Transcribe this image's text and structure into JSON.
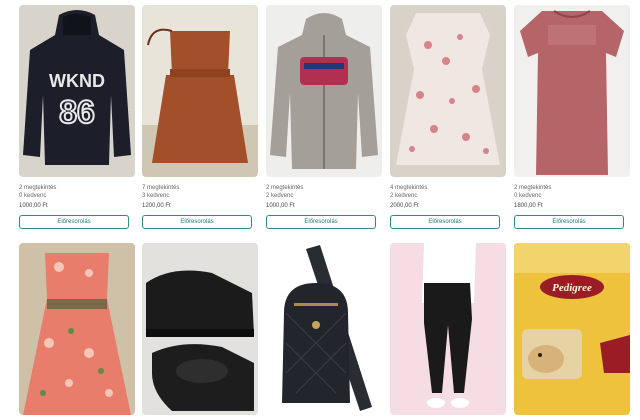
{
  "listings": [
    {
      "views": "2 megtekintés",
      "favorites": "0 kedvenc",
      "price": "1000,00 Ft",
      "button": "Előresorolás",
      "image": "black-hoodie-wknd-86",
      "print_text_1": "WKND",
      "print_text_2": "86"
    },
    {
      "views": "7 megtekintés",
      "favorites": "3 kedvenc",
      "price": "1200,00 Ft",
      "button": "Előresorolás",
      "image": "rust-strapless-dress"
    },
    {
      "views": "2 megtekintés",
      "favorites": "2 kedvenc",
      "price": "1000,00 Ft",
      "button": "Előresorolás",
      "image": "grey-zip-hoodie"
    },
    {
      "views": "4 megtekintés",
      "favorites": "2 kedvenc",
      "price": "2000,00 Ft",
      "button": "Előresorolás",
      "image": "floral-white-dress"
    },
    {
      "views": "2 megtekintés",
      "favorites": "0 kedvenc",
      "price": "1800,00 Ft",
      "button": "Előresorolás",
      "image": "pink-velvet-tunic"
    },
    {
      "image": "floral-red-dress"
    },
    {
      "image": "black-slip-on-shoes"
    },
    {
      "image": "black-quilted-sling-bag"
    },
    {
      "image": "black-leggings"
    },
    {
      "image": "pedigree-dog-food",
      "brand_text": "Pedigree"
    }
  ]
}
